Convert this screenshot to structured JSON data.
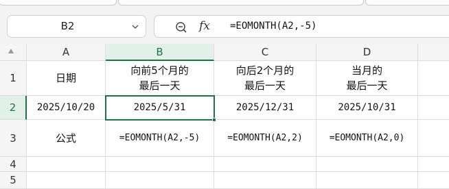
{
  "formula_bar": {
    "name_box": "B2",
    "fx_label": "fx",
    "formula": "=EOMONTH(A2,-5)"
  },
  "columns": [
    "A",
    "B",
    "C",
    "D"
  ],
  "rows": [
    "1",
    "2",
    "3",
    "4",
    "5"
  ],
  "selected_cell": "B2",
  "cells": {
    "A1": "日期",
    "B1": "向前5个月的\n最后一天",
    "C1": "向后2个月的\n最后一天",
    "D1": "当月的\n最后一天",
    "A2": "2025/10/20",
    "B2": "2025/5/31",
    "C2": "2025/12/31",
    "D2": "2025/10/31",
    "A3": "公式",
    "B3": "=EOMONTH(A2,-5)",
    "C3": "=EOMONTH(A2,2)",
    "D3": "=EOMONTH(A2,0)"
  },
  "colors": {
    "accent": "#1e7145",
    "header_bg": "#f5f5f5",
    "active_header_bg": "#e2f0ea"
  }
}
